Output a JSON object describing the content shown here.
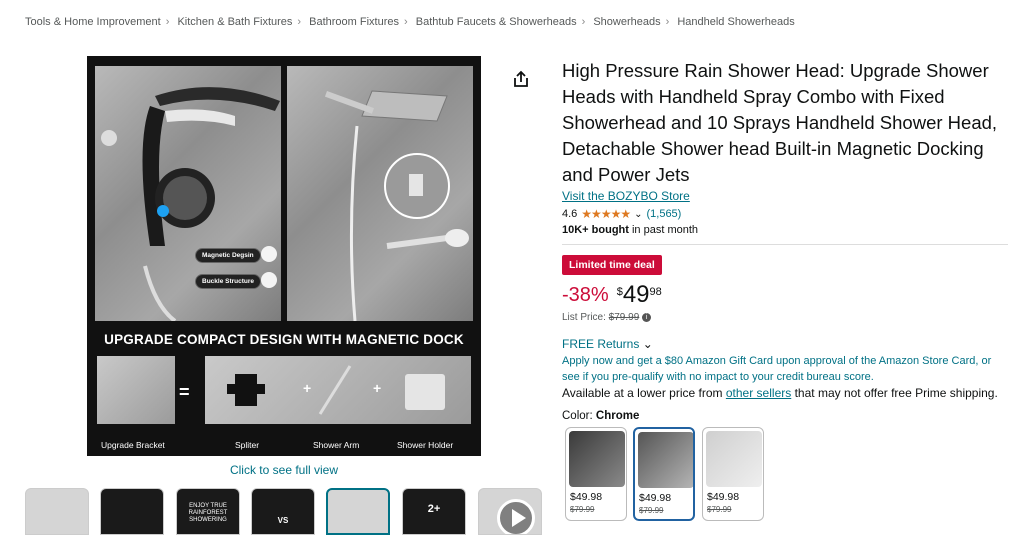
{
  "breadcrumb": [
    "Tools & Home Improvement",
    "Kitchen & Bath Fixtures",
    "Bathroom Fixtures",
    "Bathtub Faucets & Showerheads",
    "Showerheads",
    "Handheld Showerheads"
  ],
  "image": {
    "tag_magnetic": "Magnetic Degsin",
    "tag_buckle": "Buckle Structure",
    "banner": "UPGRADE COMPACT DESIGN WITH MAGNETIC DOCK",
    "eq": "=",
    "plus": "+",
    "captions": [
      "Upgrade Bracket",
      "Spliter",
      "Shower Arm",
      "Shower Holder"
    ]
  },
  "click_full_view": "Click to see full view",
  "thumbs": {
    "text_3": "ENJOY TRUE RAINFOREST SHOWERING",
    "text_4": "VS",
    "more": "2+"
  },
  "product": {
    "title": "High Pressure Rain Shower Head: Upgrade Shower Heads with Handheld Spray Combo with Fixed Showerhead and 10 Sprays Handheld Shower Head, Detachable Shower head Built-in Magnetic Docking and Power Jets",
    "store": "Visit the BOZYBO Store",
    "rating": "4.6",
    "stars": 4.6,
    "review_count": "(1,565)",
    "bought_bold": "10K+ bought",
    "bought_rest": "in past month",
    "deal_badge": "Limited time deal",
    "discount": "-38%",
    "currency": "$",
    "price_whole": "49",
    "price_fraction": "98",
    "list_price_label": "List Price:",
    "list_price": "$79.99",
    "returns": "FREE Returns",
    "offer": "Apply now and get a $80 Amazon Gift Card upon approval of the Amazon Store Card, or see if you pre-qualify with no impact to your credit bureau score.",
    "lower_prefix": "Available at a lower price from",
    "lower_link": "other sellers",
    "lower_suffix": "that may not offer free Prime shipping.",
    "color_label": "Color:",
    "color_value": "Chrome",
    "swatches": [
      {
        "price": "$49.98",
        "old": "$79.99"
      },
      {
        "price": "$49.98",
        "old": "$79.99"
      },
      {
        "price": "$49.98",
        "old": "$79.99"
      }
    ]
  },
  "colors": {
    "link": "#007185",
    "deal": "#cc0c39",
    "star": "#de7921",
    "selected_border": "#2162a1"
  }
}
